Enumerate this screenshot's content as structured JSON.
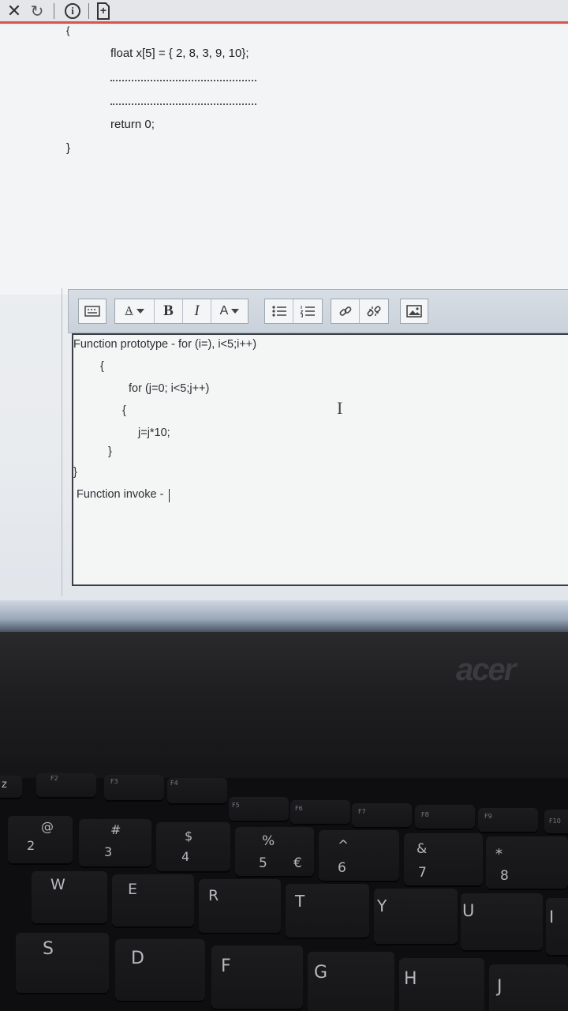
{
  "topbar": {
    "close_glyph": "✕",
    "reload_glyph": "↻",
    "info_glyph": "i",
    "new_glyph": "+"
  },
  "question_code": {
    "open_brace": "{",
    "line1": "float x[5] = { 2, 8, 3, 9, 10};",
    "line_return": "return 0;",
    "close_brace": "}"
  },
  "toolbar": {
    "font_size_label": "A",
    "bold_label": "B",
    "italic_label": "I",
    "font_color_label": "A"
  },
  "editor": {
    "lines": [
      "Function prototype - for (i=), i<5;i++)",
      "{",
      "for (j=0; i<5;j++)",
      "{",
      "j=j*10;",
      "}",
      "}",
      "Function invoke -"
    ],
    "cursor_glyph": "I"
  },
  "laptop": {
    "brand": "acer",
    "f_keys": [
      "F2",
      "F3",
      "F4",
      "F5",
      "F6",
      "F7",
      "F8",
      "F9",
      "F10"
    ],
    "number_row": [
      {
        "top": "@",
        "bottom": "2"
      },
      {
        "top": "#",
        "bottom": "3"
      },
      {
        "top": "$",
        "bottom": "4"
      },
      {
        "top": "%",
        "bottom": "5",
        "extra": "€"
      },
      {
        "top": "^",
        "bottom": "6"
      },
      {
        "top": "&",
        "bottom": "7"
      },
      {
        "top": "*",
        "bottom": "8"
      }
    ],
    "qwerty_row": [
      "W",
      "E",
      "R",
      "T",
      "Y",
      "U",
      "I"
    ],
    "home_row": [
      "S",
      "D",
      "F",
      "G",
      "H",
      "J"
    ],
    "zz_label": "z"
  },
  "colors": {
    "accent_red": "#d9534f",
    "editor_border": "#3a3f45"
  }
}
